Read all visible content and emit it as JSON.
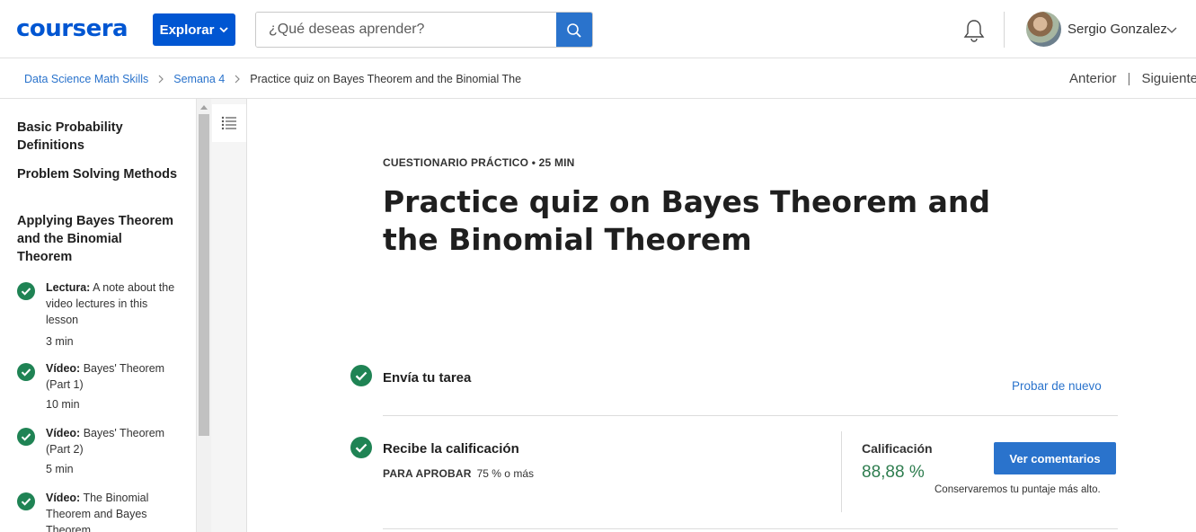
{
  "header": {
    "logo": "coursera",
    "explore_label": "Explorar",
    "search_placeholder": "¿Qué deseas aprender?",
    "user_name": "Sergio Gonzalez"
  },
  "breadcrumb": {
    "items": [
      "Data Science Math Skills",
      "Semana 4"
    ],
    "current": "Practice quiz on Bayes Theorem and the Binomial The",
    "prev_label": "Anterior",
    "separator": "|",
    "next_label": "Siguiente"
  },
  "sidebar": {
    "sections": [
      "Basic Probability Definitions",
      "Problem Solving Methods",
      "Applying Bayes Theorem and the Binomial Theorem"
    ],
    "items": [
      {
        "type": "Lectura:",
        "title": "A note about the video lectures in this lesson",
        "duration": "3 min"
      },
      {
        "type": "Vídeo:",
        "title": "Bayes' Theorem (Part 1)",
        "duration": "10 min"
      },
      {
        "type": "Vídeo:",
        "title": "Bayes' Theorem (Part 2)",
        "duration": "5 min"
      },
      {
        "type": "Vídeo:",
        "title": "The Binomial Theorem and Bayes Theorem",
        "duration": ""
      }
    ]
  },
  "main": {
    "kicker": "CUESTIONARIO PRÁCTICO • 25 MIN",
    "title": "Practice quiz on Bayes Theorem and the Binomial Theorem",
    "submit_step": "Envía tu tarea",
    "try_again": "Probar de nuevo",
    "grade_step": "Recibe la calificación",
    "pass_label": "PARA APROBAR",
    "pass_value": "75 % o más",
    "grade_label": "Calificación",
    "grade_value": "88,88 %",
    "feedback_button": "Ver comentarios",
    "keep_note": "Conservaremos tu puntaje más alto."
  },
  "colors": {
    "brand": "#0056d2",
    "link": "#2a73cc",
    "success": "#1f8354"
  }
}
